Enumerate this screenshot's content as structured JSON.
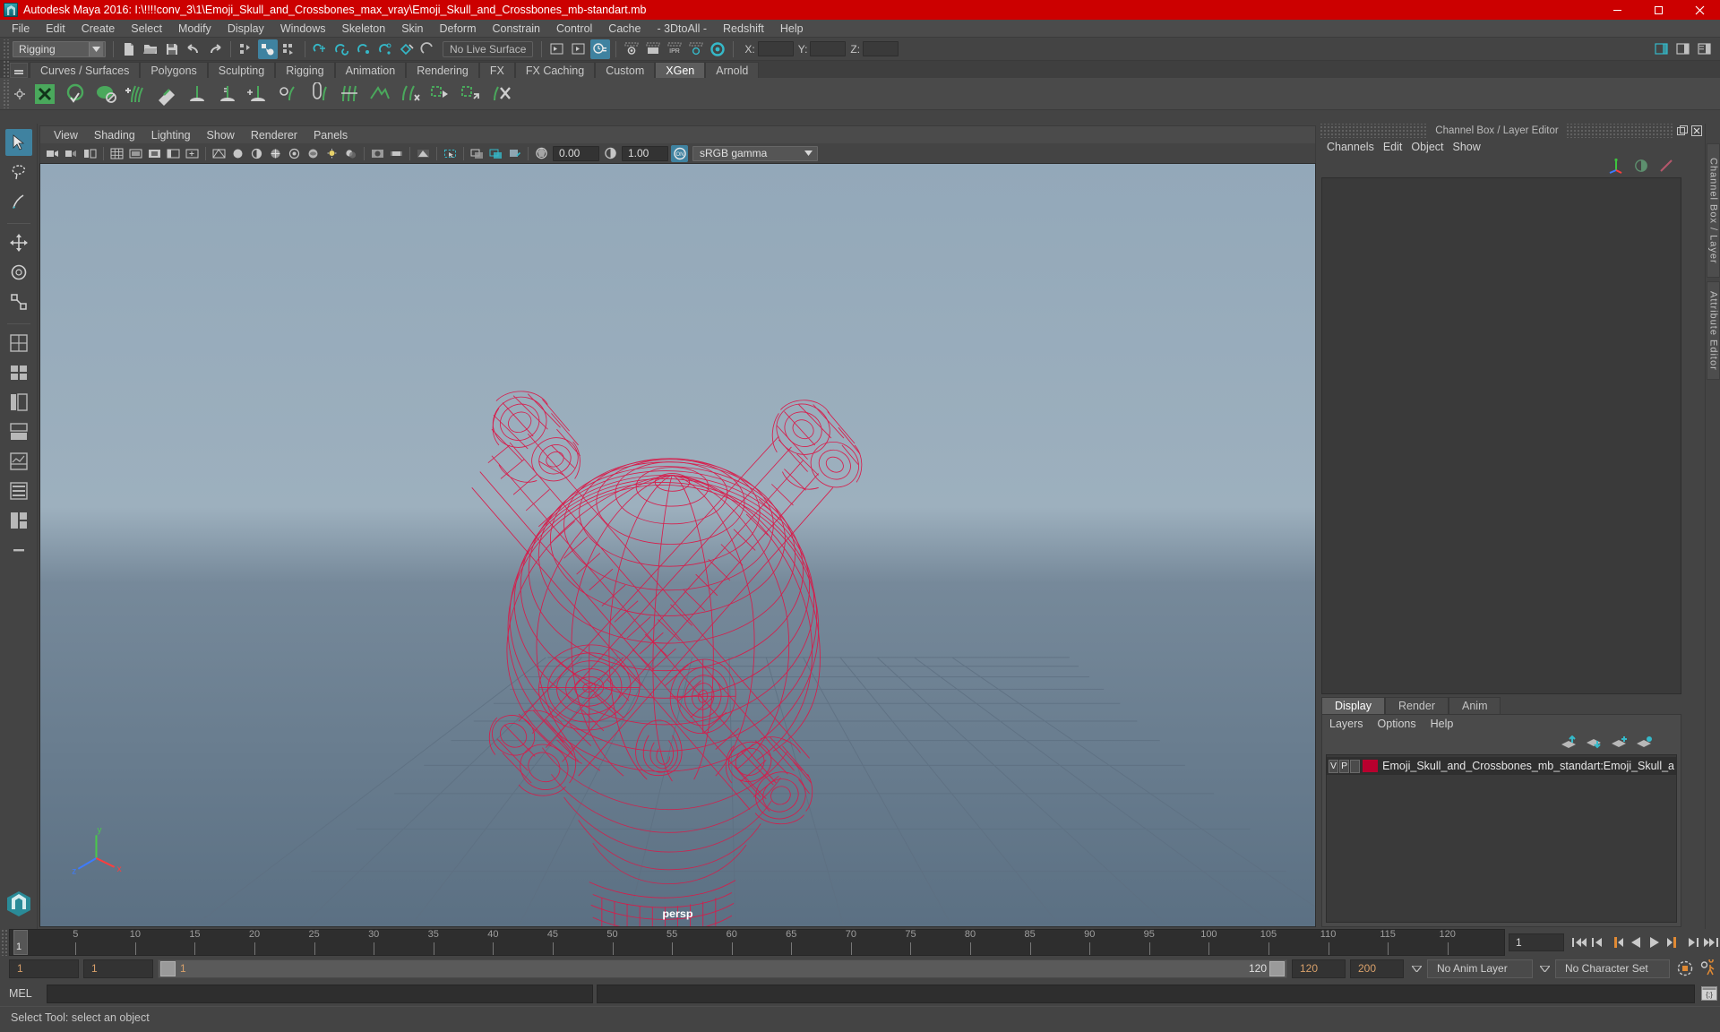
{
  "titlebar": {
    "title": "Autodesk Maya 2016: I:\\!!!!conv_3\\1\\Emoji_Skull_and_Crossbones_max_vray\\Emoji_Skull_and_Crossbones_mb-standart.mb",
    "minimize": "minimize-icon",
    "maximize": "maximize-icon",
    "close": "close-icon",
    "accent": "#cc0000"
  },
  "menubar": {
    "items": [
      "File",
      "Edit",
      "Create",
      "Select",
      "Modify",
      "Display",
      "Windows",
      "Skeleton",
      "Skin",
      "Deform",
      "Constrain",
      "Control",
      "Cache",
      "- 3DtoAll -",
      "Redshift",
      "Help"
    ]
  },
  "toolbar": {
    "menuset": "Rigging",
    "live_surface": "No Live Surface",
    "axis": {
      "x_label": "X:",
      "y_label": "Y:",
      "z_label": "Z:",
      "x_value": "",
      "y_value": "",
      "z_value": ""
    }
  },
  "shelf": {
    "tabs": [
      "Curves / Surfaces",
      "Polygons",
      "Sculpting",
      "Rigging",
      "Animation",
      "Rendering",
      "FX",
      "FX Caching",
      "Custom",
      "XGen",
      "Arnold"
    ],
    "active_tab": "XGen"
  },
  "viewport": {
    "menus": [
      "View",
      "Shading",
      "Lighting",
      "Show",
      "Renderer",
      "Panels"
    ],
    "exposure": "0.00",
    "gamma_value": "1.00",
    "color_management": "sRGB gamma",
    "camera_label": "persp"
  },
  "right_panel": {
    "title": "Channel Box / Layer Editor",
    "menus": [
      "Channels",
      "Edit",
      "Object",
      "Show"
    ],
    "vertical_tabs": [
      "Channel Box / Layer Editor",
      "Attribute Editor"
    ],
    "layer_editor": {
      "tabs": [
        "Display",
        "Render",
        "Anim"
      ],
      "active_tab": "Display",
      "menus": [
        "Layers",
        "Options",
        "Help"
      ],
      "layers": [
        {
          "visibility": "V",
          "playback": "P",
          "color": "#b8002e",
          "name": "Emoji_Skull_and_Crossbones_mb_standart:Emoji_Skull_a"
        }
      ]
    }
  },
  "timeline": {
    "ticks": [
      1,
      5,
      10,
      15,
      20,
      25,
      30,
      35,
      40,
      45,
      50,
      55,
      60,
      65,
      70,
      75,
      80,
      85,
      90,
      95,
      100,
      105,
      110,
      115,
      120
    ],
    "current_frame": "1",
    "current_frame_field": "1",
    "range_start": "1",
    "range_end": "120",
    "anim_start": "1",
    "anim_end": "120",
    "playback_end": "200",
    "anim_layer": "No Anim Layer",
    "character_set": "No Character Set",
    "rangebar_left_label": "1",
    "rangebar_right_label": "120"
  },
  "command_line": {
    "label": "MEL",
    "input": "",
    "output": ""
  },
  "status_bar": {
    "message": "Select Tool: select an object"
  },
  "colors": {
    "accent_red": "#cc0000",
    "highlight_blue": "#3f82a0",
    "wireframe_red": "#d81b4a",
    "panel_bg": "#444444"
  }
}
